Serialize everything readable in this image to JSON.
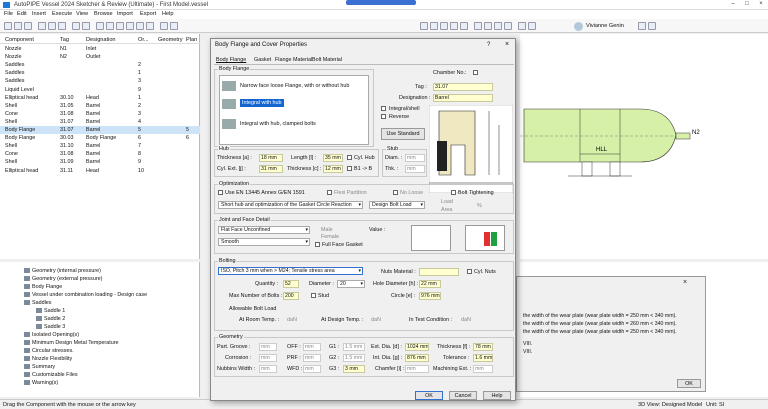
{
  "app": {
    "title": "AutoPIPE Vessel 2024 Sketcher & Review (Ultimate) - First Model.vessel",
    "user": "Vivianne Genin"
  },
  "menu": [
    "File",
    "Edit",
    "Insert",
    "Execute",
    "View",
    "Browse",
    "Import",
    "Export",
    "Help"
  ],
  "table": {
    "headers": [
      "Component",
      "Tag",
      "Designation",
      "Or...",
      "Geometry",
      "Plan"
    ],
    "rows": [
      [
        "Nozzle",
        "N1",
        "Inlet",
        "",
        "",
        ""
      ],
      [
        "Nozzle",
        "N2",
        "Outlet",
        "",
        "",
        ""
      ],
      [
        "Saddles",
        "",
        "",
        "2",
        "",
        ""
      ],
      [
        "Saddles",
        "",
        "",
        "1",
        "",
        ""
      ],
      [
        "Saddles",
        "",
        "",
        "3",
        "",
        ""
      ],
      [
        "Liquid Level",
        "",
        "",
        "9",
        "",
        ""
      ],
      [
        "Elliptical head",
        "30.10",
        "Head",
        "1",
        "",
        ""
      ],
      [
        "Shell",
        "31.05",
        "Barrel",
        "2",
        "",
        ""
      ],
      [
        "Cone",
        "31.08",
        "Barrel",
        "3",
        "",
        ""
      ],
      [
        "Shell",
        "31.07",
        "Barrel",
        "4",
        "",
        ""
      ],
      [
        "Body Flange",
        "31.07",
        "Barrel",
        "5",
        "",
        "5"
      ],
      [
        "Body Flange",
        "30.03",
        "Body Flange",
        "6",
        "",
        "6"
      ],
      [
        "Shell",
        "31.10",
        "Barrel",
        "7",
        "",
        ""
      ],
      [
        "Cone",
        "31.08",
        "Barrel",
        "8",
        "",
        ""
      ],
      [
        "Shell",
        "31.09",
        "Barrel",
        "9",
        "",
        ""
      ],
      [
        "Elliptical head",
        "31.11",
        "Head",
        "10",
        "",
        ""
      ]
    ]
  },
  "tree": [
    "Geometry (internal pressure)",
    "Geometry (external pressure)",
    "Body Flange",
    "Vessel under combination loading - Design case",
    "Saddles",
    "Saddle 1",
    "Saddle 2",
    "Saddle 3",
    "Isolated Opening(s)",
    "Minimum Design Metal Temperature",
    "Circular stresses.",
    "Nozzle Flexibility",
    "Summary",
    "Customizable Files",
    "Warning(s)"
  ],
  "status": {
    "left": "Drag the Component with the mouse or the arrow key",
    "right1": "3D View: Designed Model",
    "right2": "Unit: SI"
  },
  "dialog": {
    "title": "Body Flange and Cover Properties",
    "tabs": [
      "Body Flange",
      "Gasket",
      "Flange Material",
      "Bolt Material"
    ],
    "body_flange_group": "Body Flange",
    "types": [
      "Narrow face loose Flange, with or without hub",
      "Integral with hub",
      "Integral with hub, clamped bolts"
    ],
    "chamber_no": "Chamber No.:",
    "tag_label": "Tag :",
    "tag": "31.07",
    "designation_label": "Designation :",
    "designation": "Barrel",
    "integral_shell": "Integral/shell",
    "reverse": "Reverse",
    "use_standard": "Use Standard",
    "hub_group": "Hub",
    "thickness_label": "Thickness [a] :",
    "thickness": "18 mm",
    "length_label": "Length [l] :",
    "length": "35 mm",
    "cyl_hub": "Cyl. Hub",
    "cyl_ext_label": "Cyl. Ext. [j] :",
    "cyl_ext": "31 mm",
    "thickness2_label": "Thickness [c] :",
    "thickness2": "12 mm",
    "b1_label": "B1 -> B",
    "stub_group": "Stub",
    "diam_label": "Diam. :",
    "thk_label": "Thk. :",
    "mm": "mm",
    "optimization_group": "Optimization",
    "use_en": "Use EN 13445 Annex G/EN 1591",
    "flexi": "Flexi Partition",
    "no_loose": "No Loose",
    "bolt_tightening": "Bolt Tightening",
    "opt_select": "Short hub and optimization of the Gasket Circle Reaction",
    "design_bolt": "Design Bolt Load",
    "load": "Load",
    "area": "Area",
    "pct": "%",
    "joint_group": "Joint and Face Detail",
    "face": "Flat Face Unconfined",
    "finish": "Smooth",
    "male": "Male",
    "female": "Female",
    "full_face": "Full Face Gasket",
    "value_label": "Value :",
    "bolting_group": "Bolting",
    "bolt_select": "ISO, Pitch 3 mm when > M24; Tensile stress area",
    "nuts_material": "Nuts Material :",
    "cyl_nuts": "Cyl. Nuts",
    "quantity_label": "Quantity :",
    "quantity": "52",
    "diameter_label": "Diameter :",
    "diameter": "20",
    "hole_label": "Hole Diameter [h] :",
    "hole": "22 mm",
    "max_bolts_label": "Max Number of Bolts :",
    "max_bolts": "200",
    "stud": "Stud",
    "circle_label": "Circle [e] :",
    "circle": "976 mm",
    "allowable": "Allowable Bolt Load",
    "room_temp": "At Room Temp. :",
    "design_temp": "At Design Temp. :",
    "test_cond": "In Test Condition :",
    "dan": "daN",
    "geometry_group": "Geometry",
    "part_groove": "Part. Groove :",
    "off": "OFF :",
    "g1": "G1 :",
    "ext_dia": "Ext. Dia. [d] :",
    "ext_dia_val": "1024 mm",
    "thk_t": "Thickness [f] :",
    "thk_t_val": "78 mm",
    "corrosion": "Corrosion :",
    "prf": "PRF :",
    "g2": "G2 :",
    "int_dia": "Int. Dia. [g] :",
    "int_dia_val": "876 mm",
    "tolerance": "Tolerance :",
    "tolerance_val": "1.6 mm",
    "nubbins": "Nubbins Width :",
    "wfd": "WFD :",
    "g3": "G3 :",
    "g3_val": "3 mm",
    "chamfer": "Chamfer [i] :",
    "machining": "Machining Ext. :",
    "val_15": "1.5 mm",
    "mm_gray": "mm",
    "ok": "OK",
    "cancel": "Cancel",
    "help": "Help",
    "help_q": "?"
  },
  "message": {
    "lines": [
      "the width of the wear plate (wear plate width = 250 mm < 340 mm).",
      "the width of the wear plate (wear plate width = 260 mm < 340 mm).",
      "the width of the wear plate (wear plate width = 250 mm < 340 mm).",
      "VIII.",
      "VIII."
    ],
    "ok": "OK"
  },
  "drawing": {
    "n2": "N2",
    "hll": "HLL"
  }
}
